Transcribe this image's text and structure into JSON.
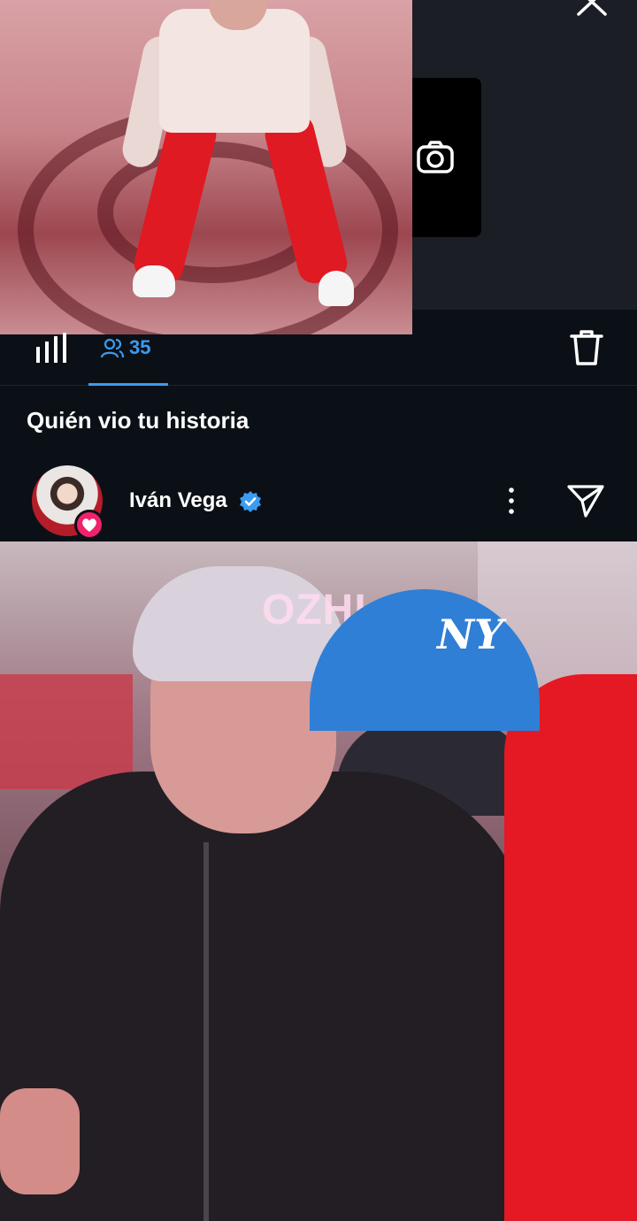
{
  "story": {
    "thumbnail_icon": "dancer-story-thumbnail",
    "close_icon": "close-icon",
    "camera_icon": "camera-icon"
  },
  "tabs": {
    "insights_icon": "bar-chart-icon",
    "viewers_icon": "people-icon",
    "viewers_count": "35",
    "delete_icon": "trash-icon"
  },
  "viewers": {
    "title": "Quién vio tu historia",
    "items": [
      {
        "name": "Iván Vega",
        "verified": true,
        "liked": true
      }
    ]
  },
  "video": {
    "watermark": "OZHI",
    "cap_logo": "NY"
  },
  "colors": {
    "background": "#0b1017",
    "accent": "#3b9cf0",
    "like": "#f0226b"
  }
}
